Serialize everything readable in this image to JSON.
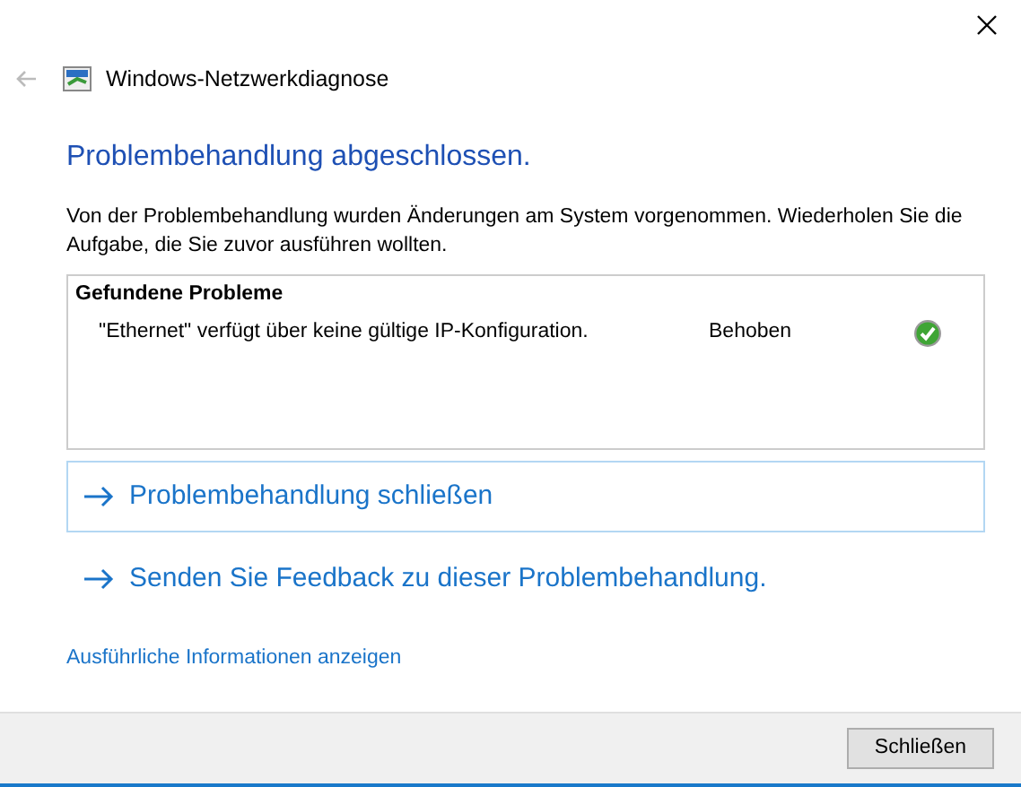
{
  "window": {
    "title": "Windows-Netzwerkdiagnose"
  },
  "heading": "Problembehandlung abgeschlossen.",
  "message": "Von der Problembehandlung wurden Änderungen am System vorgenommen. Wiederholen Sie die Aufgabe, die Sie zuvor ausführen wollten.",
  "problems": {
    "title": "Gefundene Probleme",
    "items": [
      {
        "text": "\"Ethernet\" verfügt über keine gültige IP-Konfiguration.",
        "status": "Behoben",
        "kind": "fixed"
      }
    ]
  },
  "command_links": [
    {
      "label": "Problembehandlung schließen",
      "highlighted": true
    },
    {
      "label": "Senden Sie Feedback zu dieser Problembehandlung.",
      "highlighted": false
    }
  ],
  "details_link": "Ausführliche Informationen anzeigen",
  "buttons": [
    "Schließen"
  ]
}
